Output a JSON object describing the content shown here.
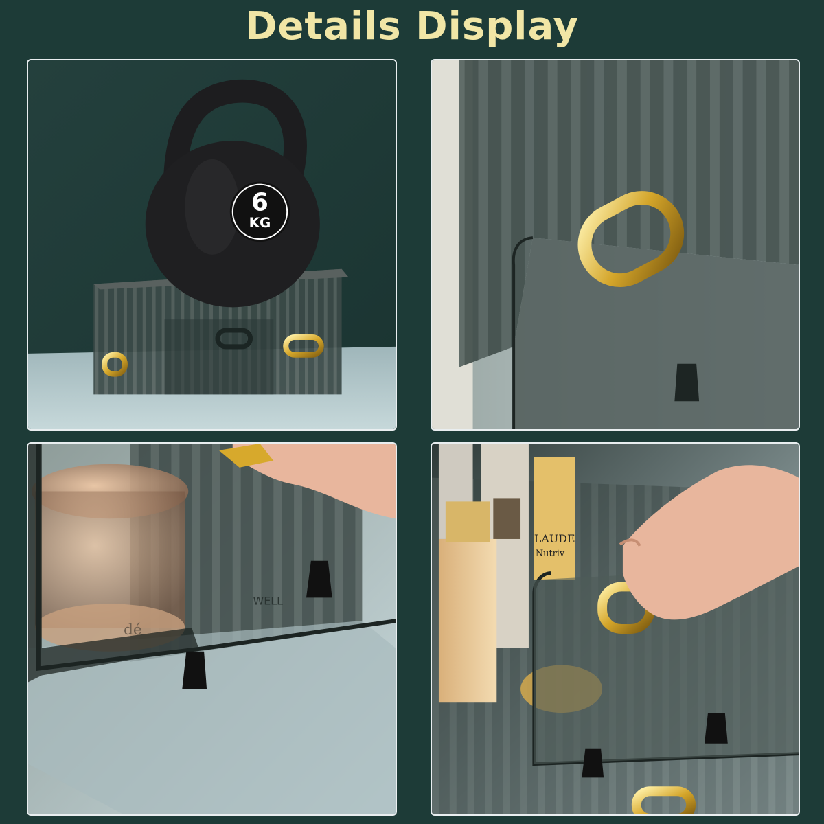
{
  "header": {
    "title": "Details Display"
  },
  "panels": {
    "weight": {
      "number": "6",
      "unit": "KG"
    },
    "cosmetics": {
      "brand_left": "dé",
      "brand_right": "LAUDE",
      "sub_right": "Nutriv",
      "bottle_text": "WELL"
    }
  },
  "colors": {
    "background": "#1d3b37",
    "title": "#f1e6a6",
    "border": "#e9eef0",
    "gold": "#d7a92c"
  }
}
